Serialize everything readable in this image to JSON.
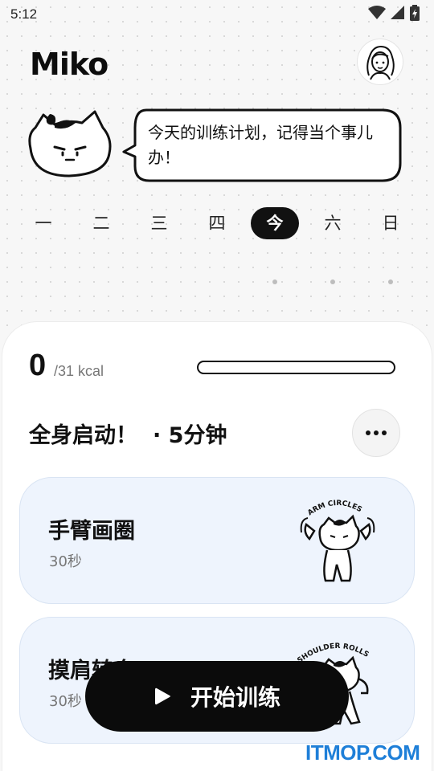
{
  "status_bar": {
    "time": "5:12"
  },
  "app": {
    "logo": "Miko"
  },
  "greeting": {
    "message": "今天的训练计划，记得当个事儿办！"
  },
  "week": {
    "days": [
      "一",
      "二",
      "三",
      "四",
      "今",
      "六",
      "日"
    ],
    "selected_index": 4
  },
  "calories": {
    "current": "0",
    "target": "/31 kcal",
    "progress": 0
  },
  "plan": {
    "title": "全身启动！",
    "duration": "· 5分钟"
  },
  "exercises": [
    {
      "name": "手臂画圈",
      "duration": "30秒",
      "sticker_caption": "ARM CIRCLES"
    },
    {
      "name": "摸肩转身",
      "duration": "30秒",
      "sticker_caption": "SHOULDER ROLLS"
    }
  ],
  "start_button": {
    "label": "开始训练"
  },
  "watermark": {
    "text": "ITMOP.COM",
    "color": "#1e7fd8"
  },
  "colors": {
    "accent": "#111111",
    "exercise_card": "#eef4fd",
    "background": "#f7f7f7"
  },
  "icons": [
    "wifi-icon",
    "signal-icon",
    "battery-icon",
    "avatar-icon",
    "more-icon",
    "play-icon"
  ]
}
